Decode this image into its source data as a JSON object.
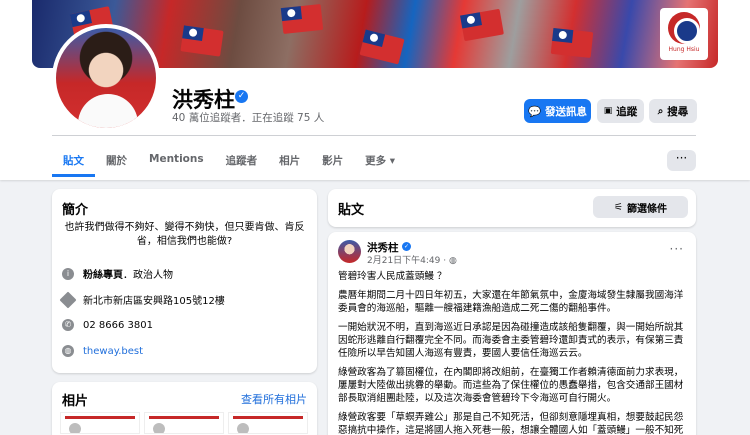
{
  "cover": {
    "logo_text": "Hung Hsiu"
  },
  "profile": {
    "name": "洪秀柱",
    "subtitle": "40 萬位追蹤者．正在追蹤 75 人"
  },
  "actions": {
    "message": "發送訊息",
    "follow": "追蹤",
    "search": "搜尋"
  },
  "tabs": [
    "貼文",
    "關於",
    "Mentions",
    "追蹤者",
    "相片",
    "影片",
    "更多 ▾"
  ],
  "intro": {
    "title": "簡介",
    "bio": "也許我們做得不夠好、變得不夠快，但只要肯做、肯反省，相信我們也能做?",
    "category_bold": "粉絲專頁",
    "category_rest": "．政治人物",
    "address": "新北市新店區安興路105號12樓",
    "phone": "02 8666 3801",
    "website": "theway.best"
  },
  "photos": {
    "title": "相片",
    "see_all": "查看所有相片"
  },
  "posts": {
    "title": "貼文",
    "filter": "篩選條件",
    "post": {
      "author": "洪秀柱",
      "time": "2月21日下午4:49 · ",
      "paragraphs": [
        "管碧玲害人民成蓋頭鰻 ？",
        "農曆年期間二月十四日年初五，大家還在年節氣氛中，金廈海域發生隸屬我國海洋委員會的海巡船，驅離一艘福建籍漁船造成二死二傷的翻船事件。",
        "一開始狀況不明，直到海巡近日承認是因為碰撞造成該船隻翻覆，與一開始所說其因蛇形逃離自行翻覆完全不同。而海委會主委管碧玲還卸責式的表示，有保第三責任險所以早告知國人海巡有豐責，要國人要信任海巡云云。",
        "綠營政客為了篡固權位，在內閣即將改組前，在臺獨工作者賴清德面前力求表現，屢屢對大陸做出挑釁的舉動。而這些為了保住權位的愚蠢舉措，包含交通部王國材部長取消組團赴陸，以及這次海委會管碧玲下令海巡可自行開火。",
        "綠營政客要「草螟弄雞公」那是自己不知死活，但卻刻意隱埋真相，想要鼓起民怨惡搞抗中操作，這是將國人拖入死巷一般，想讓全體國人如「蓋頭鰻」一般不知死活的與民進黨陪葬嗎？"
      ]
    }
  },
  "colors": {
    "accent": "#1877f2",
    "link": "#216fdb",
    "muted": "#65676b"
  }
}
